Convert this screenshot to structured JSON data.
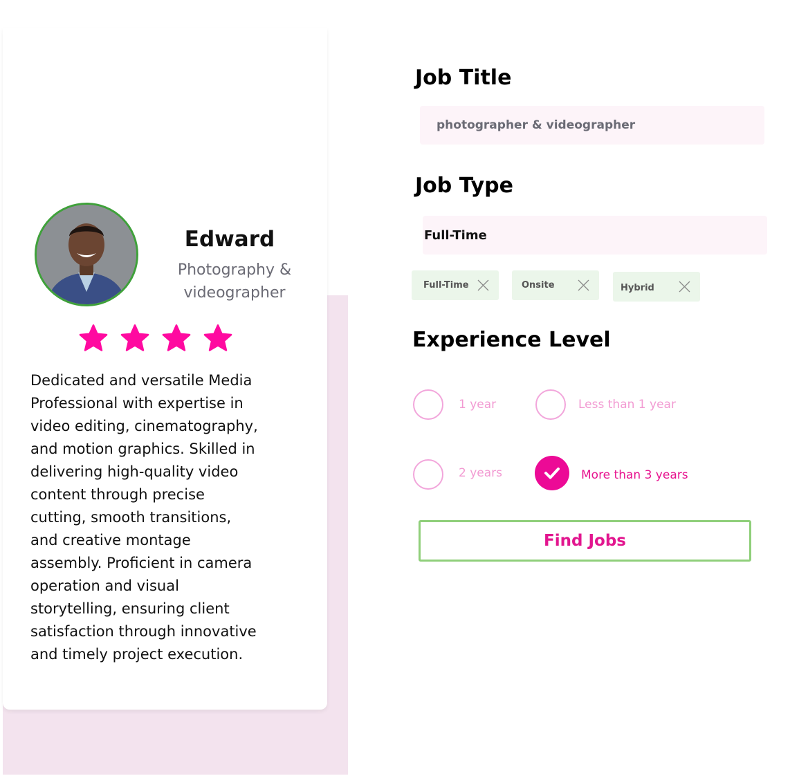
{
  "profile": {
    "name": "Edward",
    "role": "Photography & videographer",
    "rating": 4,
    "rating_max": 4,
    "bio": "Dedicated and versatile Media\nProfessional with expertise in\nvideo editing, cinematography,\nand motion graphics. Skilled in\ndelivering high-quality video\ncontent through precise\ncutting, smooth transitions,\nand creative montage\nassembly. Proficient in camera\noperation and visual\nstorytelling, ensuring client\nsatisfaction through innovative\nand timely project execution."
  },
  "form": {
    "job_title_label": "Job Title",
    "job_title_value": "photographer & videographer",
    "job_type_label": "Job Type",
    "job_type_value": "Full-Time",
    "job_type_chips": [
      "Full-Time",
      "Onsite",
      "Hybrid"
    ],
    "experience_label": "Experience Level",
    "experience_options": [
      {
        "label": "1 year",
        "selected": false
      },
      {
        "label": "Less than 1 year",
        "selected": false
      },
      {
        "label": "2 years",
        "selected": false
      },
      {
        "label": "More than 3 years",
        "selected": true
      }
    ],
    "submit_label": "Find Jobs"
  },
  "colors": {
    "accent": "#ec0a96",
    "star": "#ff0aa0",
    "avatar_border": "#3fa13a",
    "button_border": "#8fcf7a",
    "chip_bg": "#ebf6ea",
    "field_bg": "#fdf4f9",
    "panel_bg": "#f3e3ee"
  },
  "icons": {
    "star": "star-icon",
    "chip_remove": "close-icon",
    "check": "check-icon"
  }
}
